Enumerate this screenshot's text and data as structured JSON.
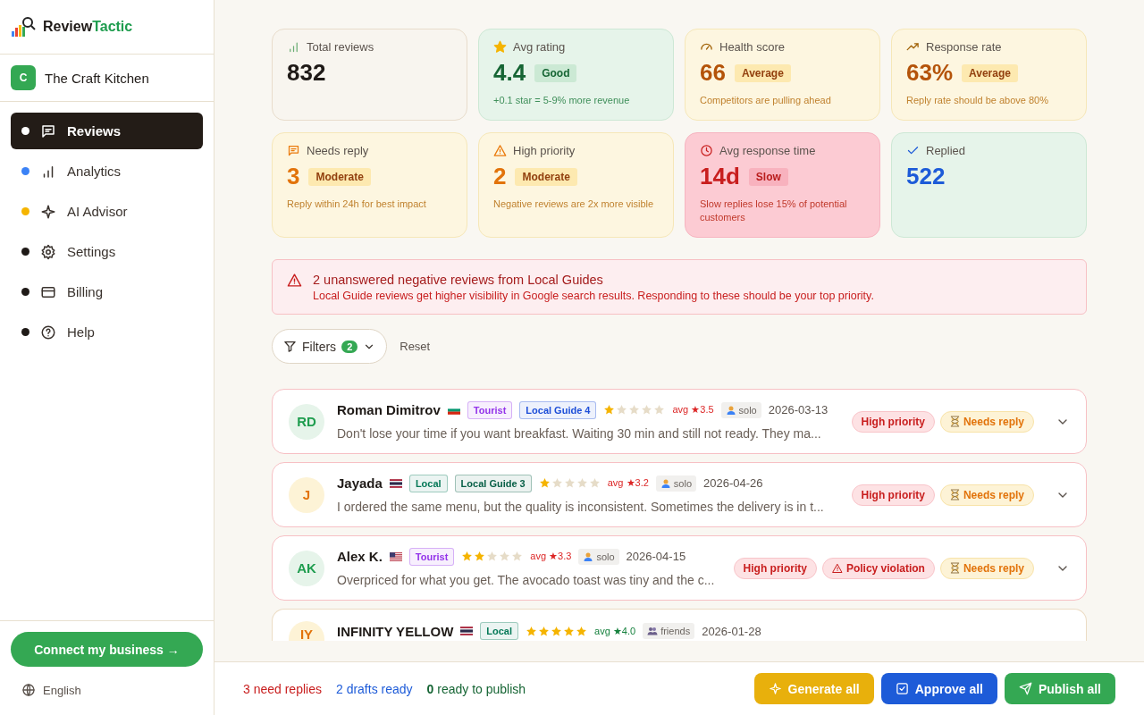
{
  "brand": {
    "dark": "Review",
    "accent": "Tactic"
  },
  "business": {
    "initial": "C",
    "name": "The Craft Kitchen"
  },
  "nav": [
    {
      "label": "Reviews",
      "color": "#ffffff",
      "selected": true
    },
    {
      "label": "Analytics",
      "color": "#3b82f6",
      "selected": false
    },
    {
      "label": "AI Advisor",
      "color": "#f5b400",
      "selected": false
    },
    {
      "label": "Settings",
      "color": "#1f1a17",
      "selected": false
    },
    {
      "label": "Billing",
      "color": "#1f1a17",
      "selected": false
    },
    {
      "label": "Help",
      "color": "#1f1a17",
      "selected": false
    }
  ],
  "connect_button": "Connect my business →",
  "language": "English",
  "stats": [
    {
      "label": "Total reviews",
      "kind": "neutral",
      "value": "832"
    },
    {
      "label": "Avg rating",
      "kind": "good",
      "value": "4.4",
      "badge": "Good",
      "note": "+0.1 star = 5-9% more revenue"
    },
    {
      "label": "Health score",
      "kind": "average",
      "value": "66",
      "badge": "Average",
      "note": "Competitors are pulling ahead"
    },
    {
      "label": "Response rate",
      "kind": "average",
      "value": "63%",
      "badge": "Average",
      "note": "Reply rate should be above 80%"
    },
    {
      "label": "Needs reply",
      "kind": "moderate",
      "value": "3",
      "badge": "Moderate",
      "note": "Reply within 24h for best impact"
    },
    {
      "label": "High priority",
      "kind": "moderate",
      "value": "2",
      "badge": "Moderate",
      "note": "Negative reviews are 2x more visible"
    },
    {
      "label": "Avg response time",
      "kind": "slow",
      "value": "14d",
      "badge": "Slow",
      "note": "Slow replies lose 15% of potential customers"
    },
    {
      "label": "Replied",
      "kind": "done",
      "value": "522"
    }
  ],
  "alert": {
    "title": "2 unanswered negative reviews from Local Guides",
    "text": "Local Guide reviews get higher visibility in Google search results. Responding to these should be your top priority."
  },
  "filters": {
    "label": "Filters",
    "count": "2",
    "reset": "Reset"
  },
  "reviews": [
    {
      "initials": "RD",
      "name": "Roman Dimitrov",
      "tags": [
        {
          "label": "Tourist",
          "color": "#9333ea"
        },
        {
          "label": "Local Guide 4",
          "color": "#1d4ed8"
        }
      ],
      "stars": 1,
      "avg": "avg ★3.5",
      "group": {
        "kind": "solo",
        "label": "solo"
      },
      "date": "2026-03-13",
      "text": "Don't lose your time if you want breakfast. Waiting 30 min and still not ready. They ma...",
      "badges": [
        {
          "kind": "high",
          "label": "High priority"
        },
        {
          "kind": "needs",
          "label": "Needs reply"
        }
      ],
      "priority": true
    },
    {
      "initials": "J",
      "name": "Jayada",
      "tags": [
        {
          "label": "Local",
          "color": "#047857"
        },
        {
          "label": "Local Guide 3",
          "color": "#065f46"
        }
      ],
      "stars": 1,
      "avg": "avg ★3.2",
      "group": {
        "kind": "solo",
        "label": "solo"
      },
      "date": "2026-04-26",
      "text": "I ordered the same menu, but the quality is inconsistent. Sometimes the delivery is in t...",
      "badges": [
        {
          "kind": "high",
          "label": "High priority"
        },
        {
          "kind": "needs",
          "label": "Needs reply"
        }
      ],
      "priority": true
    },
    {
      "initials": "AK",
      "name": "Alex K.",
      "tags": [
        {
          "label": "Tourist",
          "color": "#9333ea"
        }
      ],
      "stars": 2,
      "avg": "avg ★3.3",
      "group": {
        "kind": "solo",
        "label": "solo"
      },
      "date": "2026-04-15",
      "text": "Overpriced for what you get. The avocado toast was tiny and the c...",
      "badges": [
        {
          "kind": "high",
          "label": "High priority"
        },
        {
          "kind": "policy",
          "label": "Policy violation"
        },
        {
          "kind": "needs",
          "label": "Needs reply"
        }
      ],
      "priority": true
    },
    {
      "initials": "IY",
      "name": "INFINITY YELLOW",
      "tags": [
        {
          "label": "Local",
          "color": "#047857"
        }
      ],
      "stars": 5,
      "avg": "avg ★4.0",
      "group": {
        "kind": "friends",
        "label": "friends"
      },
      "date": "2026-01-28",
      "priority": false
    }
  ],
  "footer": {
    "need": "3 need replies",
    "drafts": "2 drafts ready",
    "publish_count": "0",
    "publish_text": "ready to publish",
    "buttons": [
      {
        "kind": "generate",
        "label": "Generate all"
      },
      {
        "kind": "approve",
        "label": "Approve all"
      },
      {
        "kind": "publish",
        "label": "Publish all"
      }
    ]
  }
}
